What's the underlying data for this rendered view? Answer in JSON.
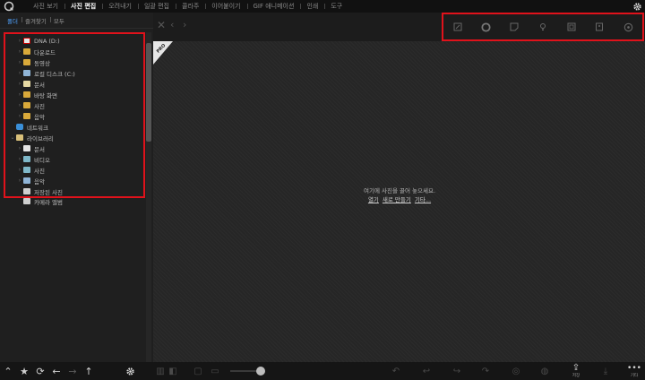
{
  "menu": {
    "tabs": [
      {
        "label": "사진 보기"
      },
      {
        "label": "사진 편집"
      },
      {
        "label": "오려내기"
      },
      {
        "label": "일괄 편집"
      },
      {
        "label": "콜라주"
      },
      {
        "label": "이어붙이기"
      },
      {
        "label": "GIF 애니메이션"
      },
      {
        "label": "인쇄"
      },
      {
        "label": "도구"
      }
    ],
    "active_tab": "사진 편집"
  },
  "left_panel": {
    "tabs": [
      {
        "label": "폴더"
      },
      {
        "label": "즐겨찾기"
      },
      {
        "label": "모두"
      }
    ],
    "tree": [
      {
        "label": "DNA (D:)"
      },
      {
        "label": "다운로드"
      },
      {
        "label": "동영상"
      },
      {
        "label": "로컬 디스크 (C:)"
      },
      {
        "label": "문서"
      },
      {
        "label": "바탕 화면"
      },
      {
        "label": "사진"
      },
      {
        "label": "음악"
      },
      {
        "label": "네트워크"
      },
      {
        "label": "라이브러리"
      },
      {
        "label": "문서"
      },
      {
        "label": "비디오"
      },
      {
        "label": "사진"
      },
      {
        "label": "음악"
      },
      {
        "label": "저장된 사진"
      },
      {
        "label": "카메라 앨범"
      }
    ]
  },
  "main": {
    "empty_message": "여기에 사진을 끌어 놓으세요.",
    "links": [
      "열기",
      "새로 만들기",
      "기타..."
    ],
    "pro_badge": "PRO"
  },
  "bottom_bar": {
    "save_label": "저장",
    "more_label": "기타"
  },
  "colors": {
    "highlight": "#e0121b",
    "active_tab": "#4fa3ff"
  }
}
